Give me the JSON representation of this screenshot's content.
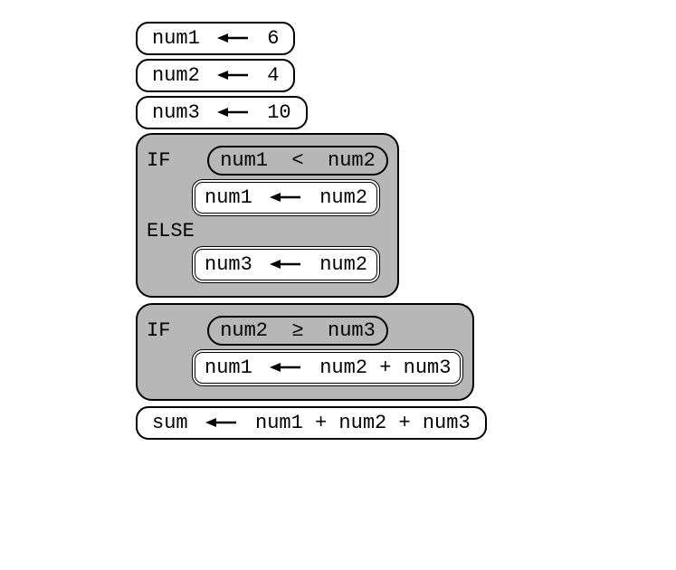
{
  "stmts": [
    {
      "lhs": "num1",
      "rhs": "6"
    },
    {
      "lhs": "num2",
      "rhs": "4"
    },
    {
      "lhs": "num3",
      "rhs": "10"
    }
  ],
  "if1": {
    "kw_if": "IF",
    "kw_else": "ELSE",
    "cond_l": "num1",
    "cond_op": "<",
    "cond_r": "num2",
    "then": {
      "lhs": "num1",
      "rhs": "num2"
    },
    "els": {
      "lhs": "num3",
      "rhs": "num2"
    }
  },
  "if2": {
    "kw_if": "IF",
    "cond_l": "num2",
    "cond_op": "≥",
    "cond_r": "num3",
    "then": {
      "lhs": "num1",
      "rhs": "num2 + num3"
    }
  },
  "final": {
    "lhs": "sum",
    "rhs": "num1 + num2 + num3"
  }
}
